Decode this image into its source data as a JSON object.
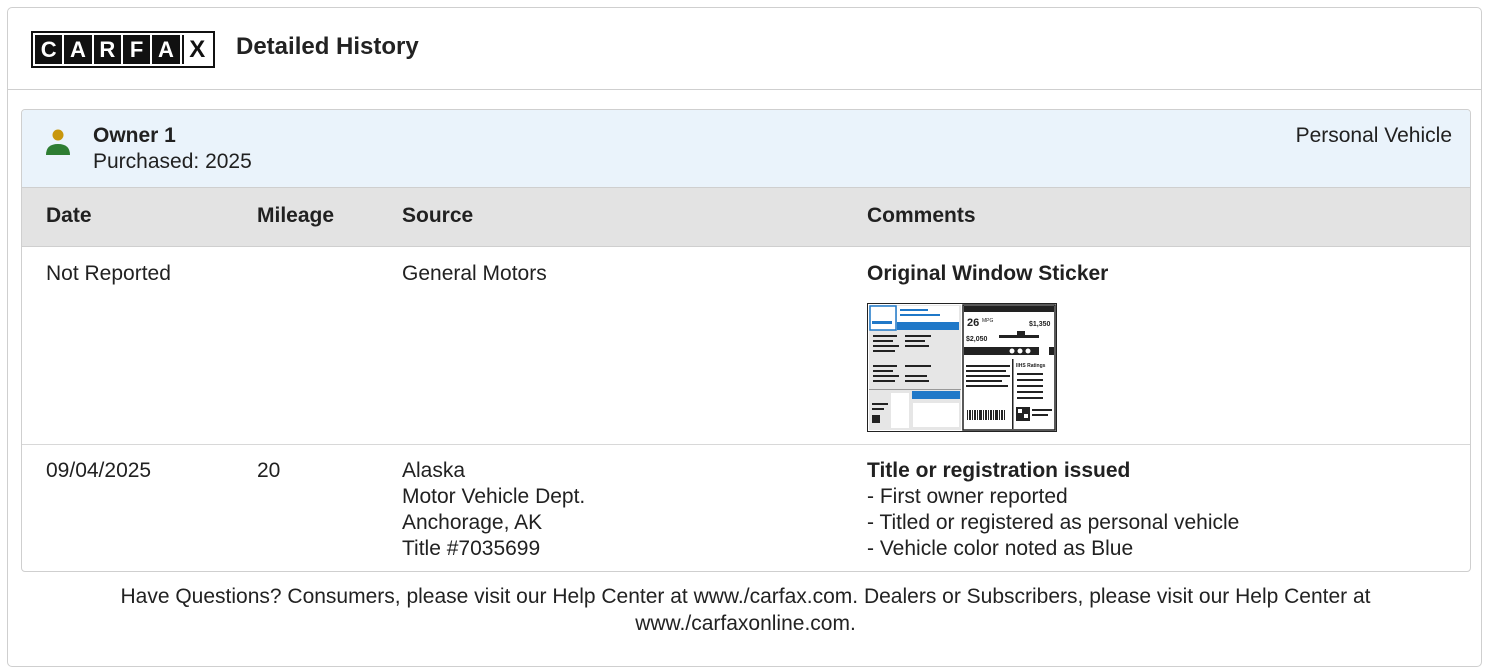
{
  "logo": {
    "letters": [
      "C",
      "A",
      "R",
      "F",
      "A",
      "X"
    ]
  },
  "header": {
    "title": "Detailed History"
  },
  "owner": {
    "name": "Owner 1",
    "purchased": "Purchased: 2025",
    "vehicle_type": "Personal Vehicle",
    "icon": "person-icon",
    "icon_colors": {
      "head": "#c8960c",
      "body": "#2e7d32"
    }
  },
  "table": {
    "headers": {
      "date": "Date",
      "mileage": "Mileage",
      "source": "Source",
      "comments": "Comments"
    },
    "rows": [
      {
        "date": "Not Reported",
        "mileage": "",
        "source": [
          "General Motors"
        ],
        "comment_title": "Original Window Sticker",
        "comment_lines": [],
        "image": "window-sticker-thumbnail"
      },
      {
        "date": "09/04/2025",
        "mileage": "20",
        "source": [
          "Alaska",
          "Motor Vehicle Dept.",
          "Anchorage, AK",
          "Title #7035699"
        ],
        "comment_title": "Title or registration issued",
        "comment_lines": [
          "- First owner reported",
          "- Titled or registered as personal vehicle",
          "- Vehicle color noted as Blue"
        ]
      }
    ]
  },
  "sticker_text": {
    "mpg": "26",
    "mpg_unit": "MPG",
    "save": "$1,350",
    "cost": "$2,050",
    "ratings": "IIHS Ratings"
  },
  "footer": {
    "line1": "Have Questions? Consumers, please visit our Help Center at www./carfax.com. Dealers or Subscribers, please visit our Help Center at",
    "line2": "www./carfaxonline.com."
  },
  "colors": {
    "owner_header_bg": "#eaf3fb",
    "table_header_bg": "#e3e3e3",
    "sticker_blue": "#1f78c8"
  }
}
